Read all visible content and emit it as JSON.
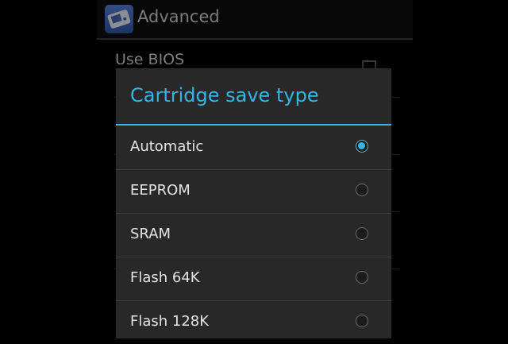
{
  "action_bar": {
    "title": "Advanced",
    "icon": "gamepad-app-icon"
  },
  "preferences": {
    "items": [
      {
        "title": "Use BIOS"
      }
    ]
  },
  "dialog": {
    "title": "Cartridge save type",
    "accent_color": "#33b5e5",
    "options": [
      {
        "label": "Automatic",
        "selected": true
      },
      {
        "label": "EEPROM",
        "selected": false
      },
      {
        "label": "SRAM",
        "selected": false
      },
      {
        "label": "Flash 64K",
        "selected": false
      },
      {
        "label": "Flash 128K",
        "selected": false
      }
    ]
  }
}
